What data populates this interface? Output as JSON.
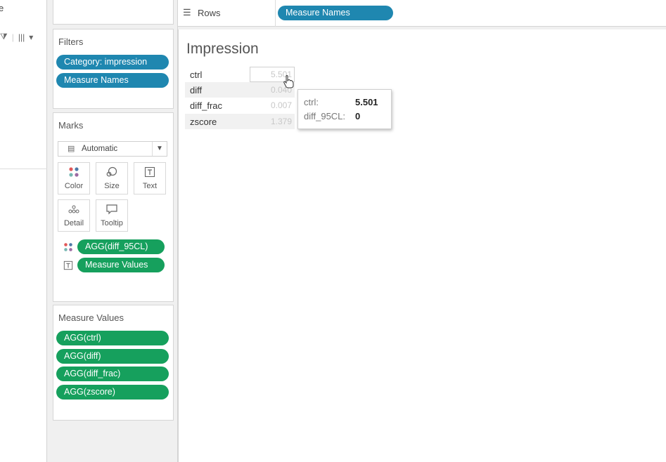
{
  "left_strip": {
    "partial_text": "e",
    "filter_glyph": "⧩",
    "columns_glyph": "|||",
    "dropdown_glyph": "▾"
  },
  "filters": {
    "title": "Filters",
    "pills": [
      "Category: impression",
      "Measure Names"
    ]
  },
  "marks": {
    "title": "Marks",
    "mark_type": "Automatic",
    "buttons": [
      {
        "label": "Color",
        "icon": "color-dots-icon"
      },
      {
        "label": "Size",
        "icon": "size-icon"
      },
      {
        "label": "Text",
        "icon": "text-icon"
      },
      {
        "label": "Detail",
        "icon": "detail-icon"
      },
      {
        "label": "Tooltip",
        "icon": "tooltip-icon"
      }
    ],
    "fields": [
      {
        "label": "AGG(diff_95CL)",
        "icon": "color-dots-icon"
      },
      {
        "label": "Measure Values",
        "icon": "text-icon"
      }
    ]
  },
  "measure_values": {
    "title": "Measure Values",
    "pills": [
      "AGG(ctrl)",
      "AGG(diff)",
      "AGG(diff_frac)",
      "AGG(zscore)"
    ]
  },
  "rows_shelf": {
    "label": "Rows",
    "pill": "Measure Names"
  },
  "view": {
    "title": "Impression",
    "rows": [
      {
        "name": "ctrl",
        "value": "5.501"
      },
      {
        "name": "diff",
        "value": "0.040"
      },
      {
        "name": "diff_frac",
        "value": "0.007"
      },
      {
        "name": "zscore",
        "value": "1.379"
      }
    ]
  },
  "tooltip": {
    "line1_key": "ctrl:",
    "line1_value": "5.501",
    "line2_key": "diff_95CL:",
    "line2_value": "0"
  },
  "colors": {
    "pill_blue": "#1f87b0",
    "pill_green": "#16a05d"
  }
}
